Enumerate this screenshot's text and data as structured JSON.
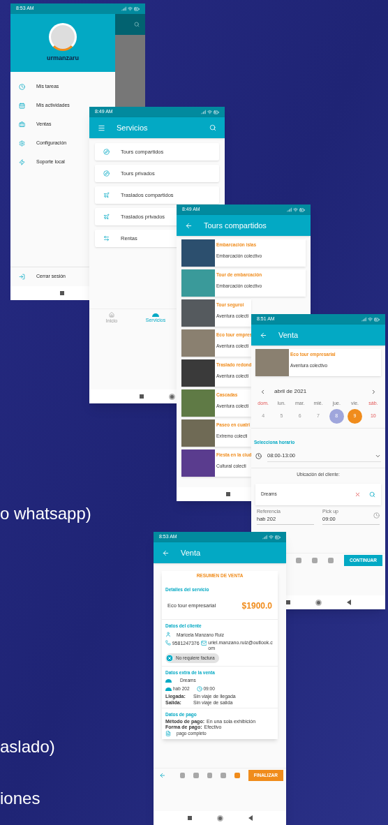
{
  "slide_text": [
    "o whatsapp)",
    "aslado)",
    "iones"
  ],
  "drawer_screen": {
    "status_time": "8:53 AM",
    "username": "urmanzaru",
    "menu": [
      "Mis tareas",
      "Mis actividades",
      "Ventas",
      "Configuración",
      "Soporte local"
    ],
    "logout": "Cerrar sesión"
  },
  "services_screen": {
    "status_time": "8:49 AM",
    "title": "Servicios",
    "items": [
      "Tours compartidos",
      "Tours privados",
      "Traslados compartidos",
      "Traslados privados",
      "Rentas"
    ],
    "bottom_nav": [
      {
        "label": "Inicio",
        "selected": false
      },
      {
        "label": "Servicios",
        "selected": true
      }
    ]
  },
  "tours_screen": {
    "status_time": "8:49 AM",
    "title": "Tours compartidos",
    "tours": [
      {
        "title": "Embarcación islas",
        "subtitle": "Embarcación colectivo"
      },
      {
        "title": "Tour de embarcación",
        "subtitle": "Embarcación colectivo"
      },
      {
        "title": "Tour seguroi",
        "subtitle": "Aventura colecti"
      },
      {
        "title": "Eco tour empres",
        "subtitle": "Aventura colecti"
      },
      {
        "title": "Traslado redond",
        "subtitle": "Aventura colecti"
      },
      {
        "title": "Cascadas",
        "subtitle": "Aventura colecti"
      },
      {
        "title": "Paseo en cuatri",
        "subtitle": "Extremo colecti"
      },
      {
        "title": "Fiesta en la ciud",
        "subtitle": "Cultural colecti"
      }
    ]
  },
  "sale_screen": {
    "status_time": "8:51 AM",
    "title": "Venta",
    "tour": {
      "title": "Eco tour empresarial",
      "subtitle": "Aventura colectivo"
    },
    "month": "abril de 2021",
    "weekdays": [
      {
        "label": "dom.",
        "weekend": true
      },
      {
        "label": "lun.",
        "weekend": false
      },
      {
        "label": "mar.",
        "weekend": false
      },
      {
        "label": "mié.",
        "weekend": false
      },
      {
        "label": "jue.",
        "weekend": false
      },
      {
        "label": "vie.",
        "weekend": false
      },
      {
        "label": "sáb.",
        "weekend": true
      }
    ],
    "days": [
      {
        "label": "4",
        "kind": "disabled"
      },
      {
        "label": "5",
        "kind": "disabled"
      },
      {
        "label": "6",
        "kind": "disabled"
      },
      {
        "label": "7",
        "kind": "disabled"
      },
      {
        "label": "8",
        "kind": "today"
      },
      {
        "label": "9",
        "kind": "selected"
      },
      {
        "label": "10",
        "kind": "weekend"
      }
    ],
    "schedule_label": "Selecciona horario",
    "schedule_value": "08:00-13:00",
    "location_label": "Ubicación del cliente:",
    "location_value": "Dreams",
    "reference": {
      "label": "Referencia",
      "value": "hab 202"
    },
    "pickup": {
      "label": "Pick up",
      "value": "09:00"
    },
    "steps": [
      {
        "selected": false
      },
      {
        "selected": false
      },
      {
        "selected": false
      }
    ],
    "button": "CONTINUAR"
  },
  "summary_screen": {
    "status_time": "8:53 AM",
    "title": "Venta",
    "heading": "RESUMEN DE VENTA",
    "service_label": "Detalles del servicio",
    "service_name": "Eco tour empresarial",
    "price": "$1900.0",
    "client_label": "Datos del cliente",
    "client_name": "Maricela Manzano Ruiz",
    "phone": "9581247376",
    "email": "uriel.manzano.ruiz@outlook.com",
    "invoice_chip": "No requiere factura",
    "extra_label": "Datos extra de la venta",
    "hotel": "Dreams",
    "room": "hab 202",
    "pickup_time": "09:00",
    "arrival": {
      "label": "Llegada:",
      "value": "Sin viaje de llegada"
    },
    "departure": {
      "label": "Salida:",
      "value": "Sin viaje de salida"
    },
    "payment_label": "Datos de pago",
    "method": {
      "label": "Método de pago:",
      "value": "En una sola exhibición"
    },
    "form": {
      "label": "Forma de pago:",
      "value": "Efectivo"
    },
    "payment_status": "pago completo",
    "steps": [
      {
        "selected": false
      },
      {
        "selected": false
      },
      {
        "selected": false
      },
      {
        "selected": false
      },
      {
        "selected": true
      }
    ],
    "button": "FINALIZAR"
  }
}
